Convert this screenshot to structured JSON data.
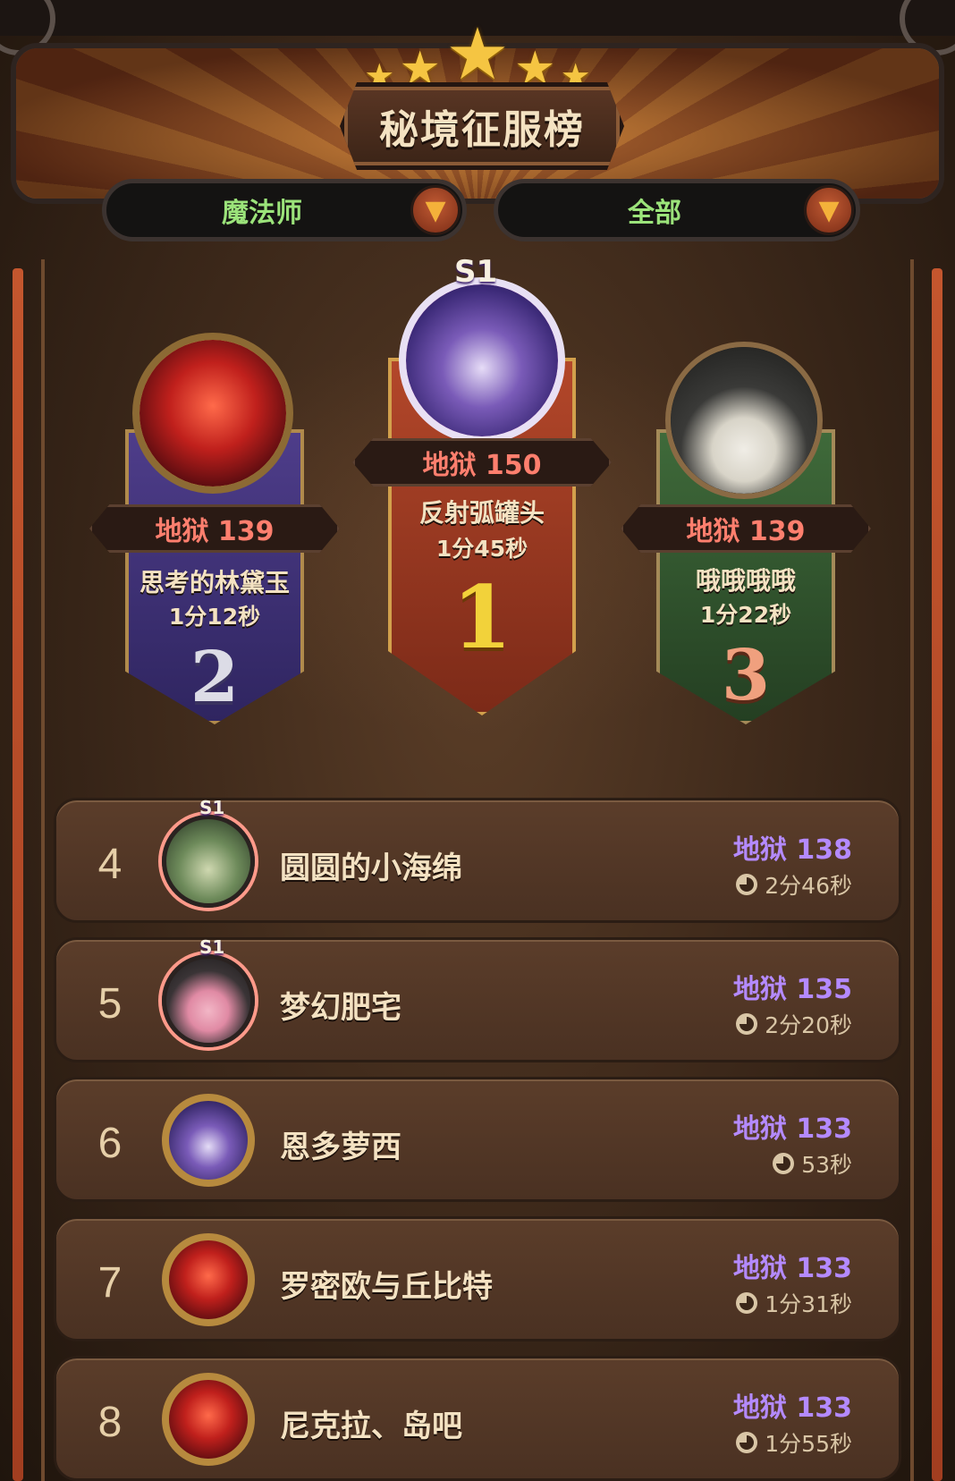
{
  "header": {
    "title": "秘境征服榜",
    "stars": [
      "star-icon",
      "star-icon",
      "star-icon",
      "star-icon",
      "star-icon"
    ]
  },
  "filters": {
    "class_label": "魔法师",
    "scope_label": "全部"
  },
  "podium": [
    {
      "rank": "1",
      "season_badge": "S1",
      "level": "地狱 150",
      "name": "反射弧罐头",
      "time": "1分45秒",
      "color": "#e8c230"
    },
    {
      "rank": "2",
      "level": "地狱 139",
      "name": "思考的林黛玉",
      "time": "1分12秒",
      "color": "#d8d8e0"
    },
    {
      "rank": "3",
      "level": "地狱 139",
      "name": "哦哦哦哦",
      "time": "1分22秒",
      "color": "#e8a07a"
    }
  ],
  "list": [
    {
      "rank": "4",
      "season_badge": "S1",
      "name": "圆圆的小海绵",
      "level": "地狱 138",
      "time": "2分46秒"
    },
    {
      "rank": "5",
      "season_badge": "S1",
      "name": "梦幻肥宅",
      "level": "地狱 135",
      "time": "2分20秒"
    },
    {
      "rank": "6",
      "name": "恩多萝西",
      "level": "地狱 133",
      "time": "53秒"
    },
    {
      "rank": "7",
      "name": "罗密欧与丘比特",
      "level": "地狱 133",
      "time": "1分31秒"
    },
    {
      "rank": "8",
      "name": "尼克拉、岛吧",
      "level": "地狱 133",
      "time": "1分55秒"
    }
  ],
  "colors": {
    "level_purple": "#b48aff",
    "level_red": "#ff7f6e",
    "filter_green": "#9be37a",
    "gold": "#f5c542"
  }
}
